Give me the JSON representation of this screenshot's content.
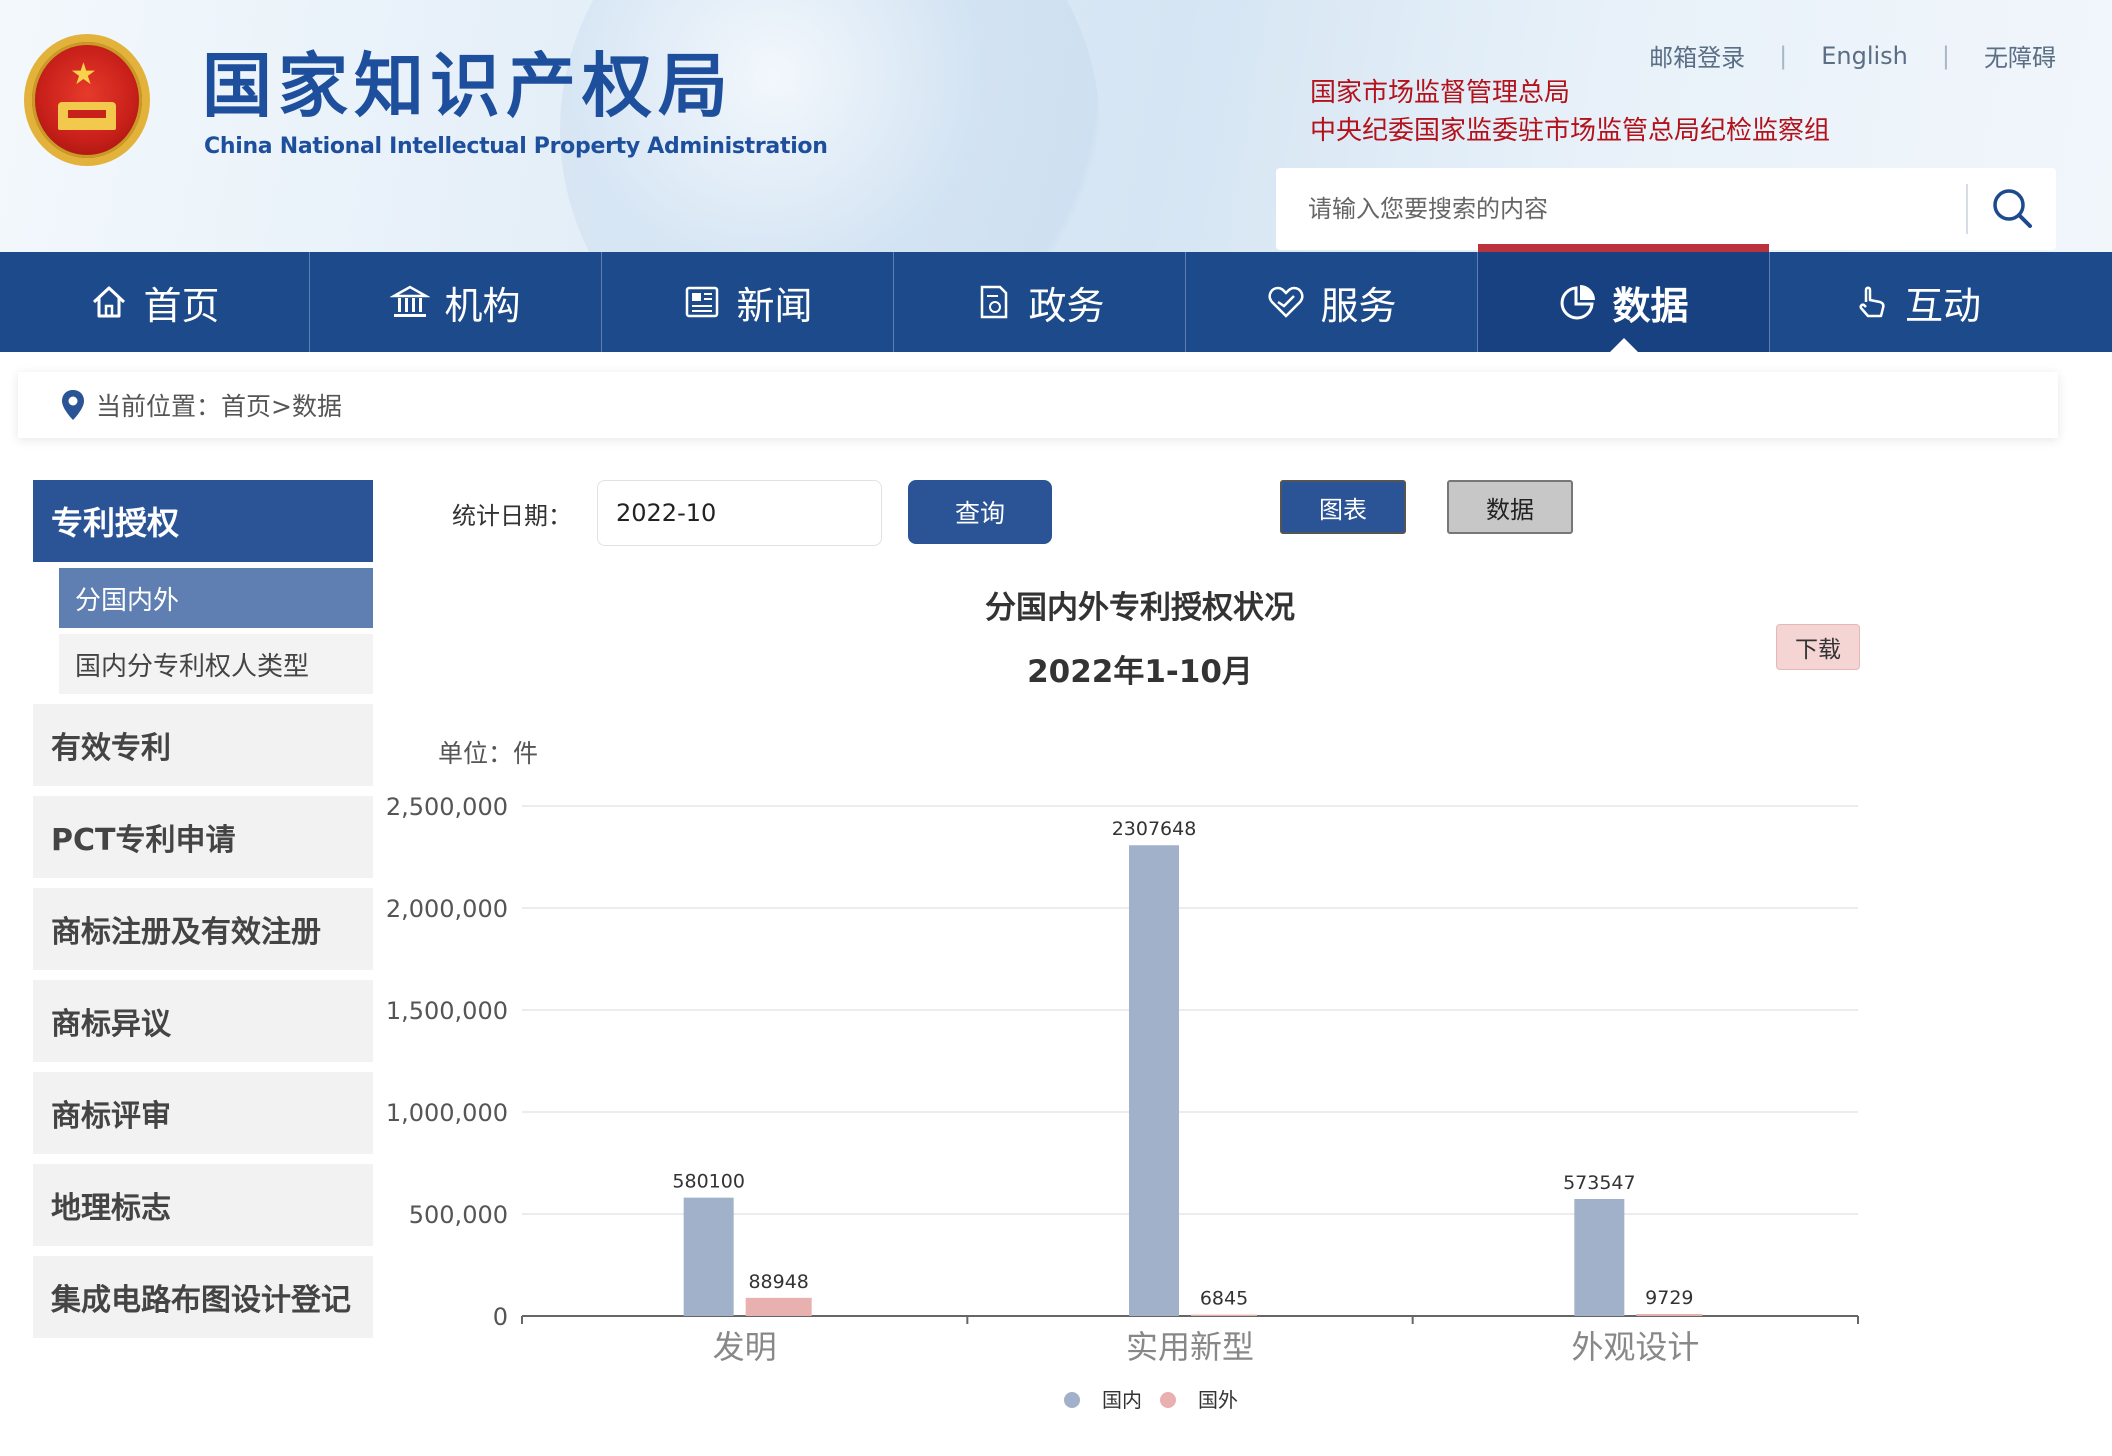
{
  "header": {
    "logo_cn": "国家知识产权局",
    "logo_en": "China National Intellectual Property Administration",
    "topnav": [
      "邮箱登录",
      "English",
      "无障碍"
    ],
    "red_links": [
      "国家市场监督管理总局",
      "中央纪委国家监委驻市场监管总局纪检监察组"
    ],
    "search_placeholder": "请输入您要搜索的内容"
  },
  "nav": [
    {
      "label": "首页",
      "icon": "home-icon"
    },
    {
      "label": "机构",
      "icon": "institution-icon"
    },
    {
      "label": "新闻",
      "icon": "news-icon"
    },
    {
      "label": "政务",
      "icon": "government-icon"
    },
    {
      "label": "服务",
      "icon": "service-icon"
    },
    {
      "label": "数据",
      "icon": "data-icon",
      "active": true
    },
    {
      "label": "互动",
      "icon": "interaction-icon"
    }
  ],
  "breadcrumb": "当前位置：首页>数据",
  "sidebar": {
    "head": "专利授权",
    "subs": [
      {
        "label": "分国内外",
        "active": true
      },
      {
        "label": "国内分专利权人类型",
        "active": false
      }
    ],
    "items": [
      "有效专利",
      "PCT专利申请",
      "商标注册及有效注册",
      "商标异议",
      "商标评审",
      "地理标志",
      "集成电路布图设计登记"
    ]
  },
  "controls": {
    "date_label": "统计日期：",
    "date_value": "2022-10",
    "query_label": "查询",
    "chart_label": "图表",
    "data_label": "数据",
    "download_label": "下载",
    "unit_label": "单位：件"
  },
  "colors": {
    "brand_blue": "#1d4a8b",
    "domestic": "#a0b1c9",
    "foreign": "#e8b0ae",
    "active_red": "#b9323c"
  },
  "chart_data": {
    "type": "bar",
    "title": "分国内外专利授权状况",
    "subtitle": "2022年1-10月",
    "ylabel": "单位：件",
    "categories": [
      "发明",
      "实用新型",
      "外观设计"
    ],
    "series": [
      {
        "name": "国内",
        "values": [
          580100,
          2307648,
          573547
        ]
      },
      {
        "name": "国外",
        "values": [
          88948,
          6845,
          9729
        ]
      }
    ],
    "ylim": [
      0,
      2500000
    ],
    "yticks": [
      "0",
      "500,000",
      "1,000,000",
      "1,500,000",
      "2,000,000",
      "2,500,000"
    ],
    "grid": true,
    "legend": "bottom-center"
  }
}
